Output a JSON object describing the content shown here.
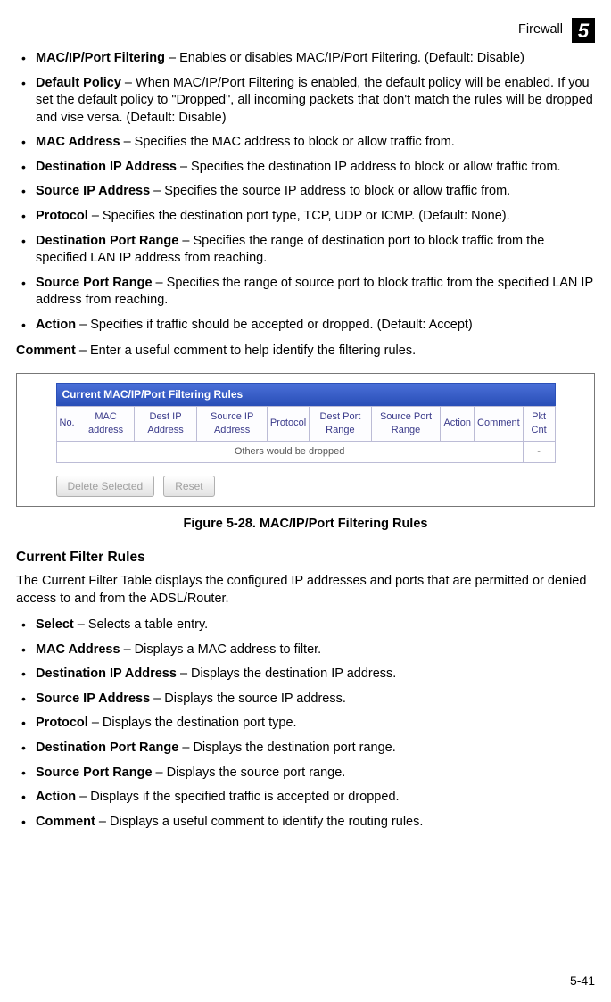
{
  "header": {
    "section_label": "Firewall",
    "chapter_number": "5"
  },
  "top_bullets": [
    {
      "term": "MAC/IP/Port Filtering",
      "desc": " – Enables or disables MAC/IP/Port Filtering. (Default: Disable)"
    },
    {
      "term": "Default Policy",
      "desc": " – When MAC/IP/Port Filtering is enabled, the default policy will be enabled. If you set the default policy to \"Dropped\", all incoming packets that don't match the rules will be dropped and vise versa. (Default: Disable)"
    },
    {
      "term": "MAC Address",
      "desc": " – Specifies the MAC address to block or allow traffic from."
    },
    {
      "term": "Destination IP Address",
      "desc": " – Specifies the destination IP address to block or allow traffic from."
    },
    {
      "term": "Source IP Address",
      "desc": " – Specifies the source IP address to block or allow traffic from."
    },
    {
      "term": "Protocol",
      "desc": " – Specifies the destination port type, TCP, UDP or ICMP. (Default: None)."
    },
    {
      "term": "Destination Port Range",
      "desc": " – Specifies the range of destination port to block traffic from the specified LAN IP address from reaching."
    },
    {
      "term": "Source Port Range",
      "desc": " – Specifies the range of source port to block traffic from the specified LAN IP address from reaching."
    },
    {
      "term": "Action",
      "desc": " – Specifies if traffic should be accepted or dropped. (Default: Accept)"
    }
  ],
  "comment_line": {
    "term": "Comment",
    "desc": " – Enter a useful comment to help identify the filtering rules."
  },
  "rules_panel": {
    "title": "Current MAC/IP/Port Filtering Rules",
    "headers": [
      "No.",
      "MAC address",
      "Dest IP Address",
      "Source IP Address",
      "Protocol",
      "Dest Port Range",
      "Source Port Range",
      "Action",
      "Comment",
      "Pkt Cnt"
    ],
    "empty_row_text": "Others would be dropped",
    "empty_row_tail": "-",
    "buttons": {
      "delete": "Delete Selected",
      "reset": "Reset"
    }
  },
  "figure_caption": "Figure 5-28.   MAC/IP/Port Filtering Rules",
  "section2": {
    "heading": "Current Filter Rules",
    "intro": "The Current Filter Table displays the configured IP addresses and ports that are permitted or denied access to and from the ADSL/Router.",
    "bullets": [
      {
        "term": "Select",
        "desc": " – Selects a table entry."
      },
      {
        "term": "MAC Address",
        "desc": " – Displays a MAC address to filter."
      },
      {
        "term": "Destination IP Address",
        "desc": " – Displays the destination IP address."
      },
      {
        "term": "Source IP Address",
        "desc": " – Displays the source IP address."
      },
      {
        "term": "Protocol",
        "desc": " – Displays the destination port type."
      },
      {
        "term": "Destination Port Range",
        "desc": " – Displays the destination port range."
      },
      {
        "term": "Source Port Range",
        "desc": " – Displays the source port range."
      },
      {
        "term": "Action",
        "desc": " – Displays if the specified traffic is accepted or dropped."
      },
      {
        "term": "Comment",
        "desc": " – Displays a useful comment to identify the routing rules."
      }
    ]
  },
  "page_number": "5-41"
}
